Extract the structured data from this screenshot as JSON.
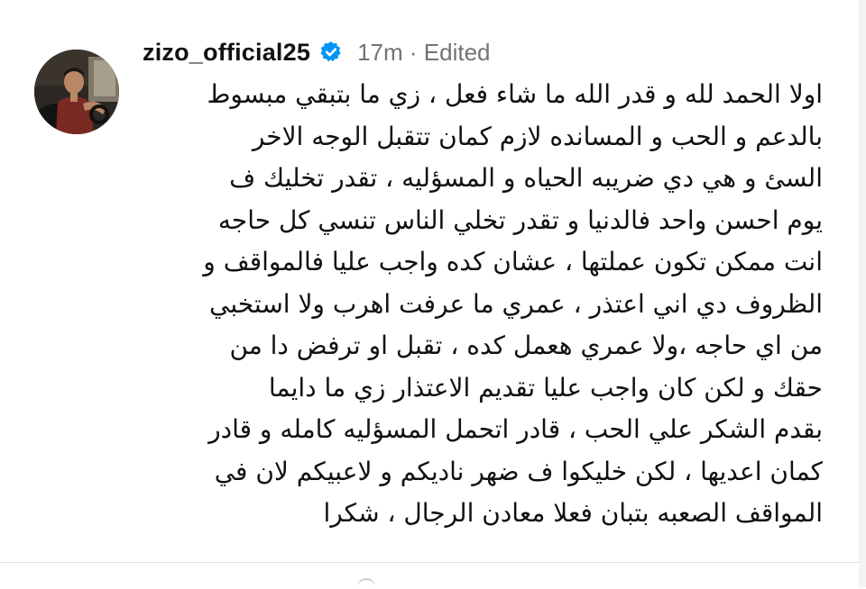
{
  "post": {
    "username": "zizo_official25",
    "verified_icon": "verified-badge-icon",
    "time": "17m",
    "separator": "·",
    "edited_label": "Edited",
    "caption_lines": [
      "اولا الحمد لله و قدر الله ما شاء فعل ،  زي ما بتبقي مبسوط",
      "بالدعم و الحب و المسانده لازم كمان تتقبل الوجه الاخر",
      "السئ و هي دي ضريبه الحياه و المسؤليه ، تقدر تخليك ف",
      "يوم احسن واحد فالدنيا و تقدر تخلي الناس تنسي كل حاجه",
      "انت ممكن تكون عملتها ، عشان كده واجب  عليا فالمواقف و",
      "الظروف دي اني اعتذر ، عمري ما عرفت اهرب ولا استخبي",
      "من اي حاجه ،ولا عمري هعمل كده ، تقبل او ترفض دا من",
      "حقك و لكن كان واجب عليا تقديم الاعتذار  زي ما دايما",
      "بقدم الشكر علي الحب ، قادر اتحمل المسؤليه كامله و قادر",
      "كمان اعديها ، لكن خليكوا ف ضهر ناديكم و لاعبيكم لان في",
      "المواقف الصعبه بتبان فعلا معادن  الرجال ، شكرا"
    ]
  },
  "colors": {
    "verified_blue": "#0095f6",
    "meta_gray": "#737373",
    "text": "#111111"
  }
}
